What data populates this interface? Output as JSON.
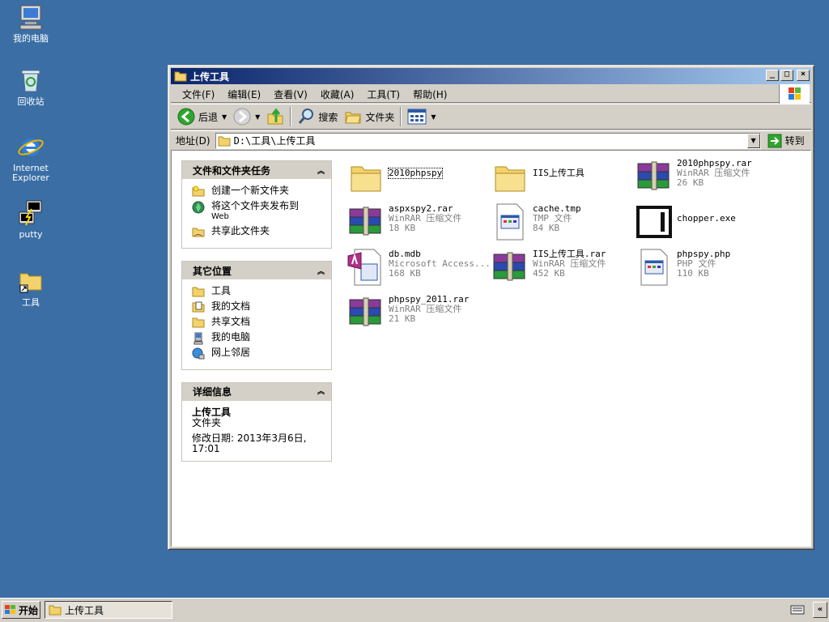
{
  "desktop": {
    "icons": [
      {
        "label": "我的电脑",
        "icon": "my-computer-icon"
      },
      {
        "label": "回收站",
        "icon": "recycle-bin-icon"
      },
      {
        "label": "Internet Explorer",
        "icon": "internet-explorer-icon"
      },
      {
        "label": "putty",
        "icon": "putty-icon"
      },
      {
        "label": "工具",
        "icon": "folder-shortcut-icon"
      }
    ]
  },
  "window": {
    "title": "上传工具",
    "controls": {
      "minimize": "_",
      "maximize": "□",
      "close": "×"
    },
    "menu": [
      "文件(F)",
      "编辑(E)",
      "查看(V)",
      "收藏(A)",
      "工具(T)",
      "帮助(H)"
    ],
    "toolbar": {
      "back": "后退",
      "search": "搜索",
      "folders": "文件夹"
    },
    "address": {
      "label": "地址(D)",
      "value": "D:\\工具\\上传工具",
      "go": "转到"
    }
  },
  "taskpane": {
    "file_tasks": {
      "title": "文件和文件夹任务",
      "items": [
        {
          "label": "创建一个新文件夹",
          "icon": "new-folder-icon"
        },
        {
          "label": "将这个文件夹发布到",
          "sub": "Web",
          "icon": "publish-web-icon"
        },
        {
          "label": "共享此文件夹",
          "icon": "share-folder-icon"
        }
      ]
    },
    "other_places": {
      "title": "其它位置",
      "items": [
        {
          "label": "工具",
          "icon": "folder-icon"
        },
        {
          "label": "我的文档",
          "icon": "my-documents-icon"
        },
        {
          "label": "共享文档",
          "icon": "shared-documents-icon"
        },
        {
          "label": "我的电脑",
          "icon": "my-computer-icon"
        },
        {
          "label": "网上邻居",
          "icon": "network-places-icon"
        }
      ]
    },
    "details": {
      "title": "详细信息",
      "name": "上传工具",
      "type": "文件夹",
      "modified_label": "修改日期: 2013年3月6日,",
      "modified_time": "17:01"
    }
  },
  "files": [
    {
      "name": "2010phpspy",
      "type": "",
      "size": "",
      "icon": "folder-icon",
      "selected": true
    },
    {
      "name": "IIS上传工具",
      "type": "",
      "size": "",
      "icon": "folder-icon"
    },
    {
      "name": "2010phpspy.rar",
      "type": "WinRAR 压缩文件",
      "size": "26 KB",
      "icon": "winrar-archive-icon"
    },
    {
      "name": "aspxspy2.rar",
      "type": "WinRAR 压缩文件",
      "size": "18 KB",
      "icon": "winrar-archive-icon"
    },
    {
      "name": "cache.tmp",
      "type": "TMP 文件",
      "size": "84 KB",
      "icon": "tmp-file-icon"
    },
    {
      "name": "chopper.exe",
      "type": "",
      "size": "",
      "icon": "exe-app-icon"
    },
    {
      "name": "db.mdb",
      "type": "Microsoft Access...",
      "size": "168 KB",
      "icon": "access-db-icon"
    },
    {
      "name": "IIS上传工具.rar",
      "type": "WinRAR 压缩文件",
      "size": "452 KB",
      "icon": "winrar-archive-icon"
    },
    {
      "name": "phpspy.php",
      "type": "PHP 文件",
      "size": "110 KB",
      "icon": "php-file-icon"
    },
    {
      "name": "phpspy_2011.rar",
      "type": "WinRAR 压缩文件",
      "size": "21 KB",
      "icon": "winrar-archive-icon"
    }
  ],
  "taskbar": {
    "start": "开始",
    "task": "上传工具",
    "tray_arrow": "«"
  }
}
